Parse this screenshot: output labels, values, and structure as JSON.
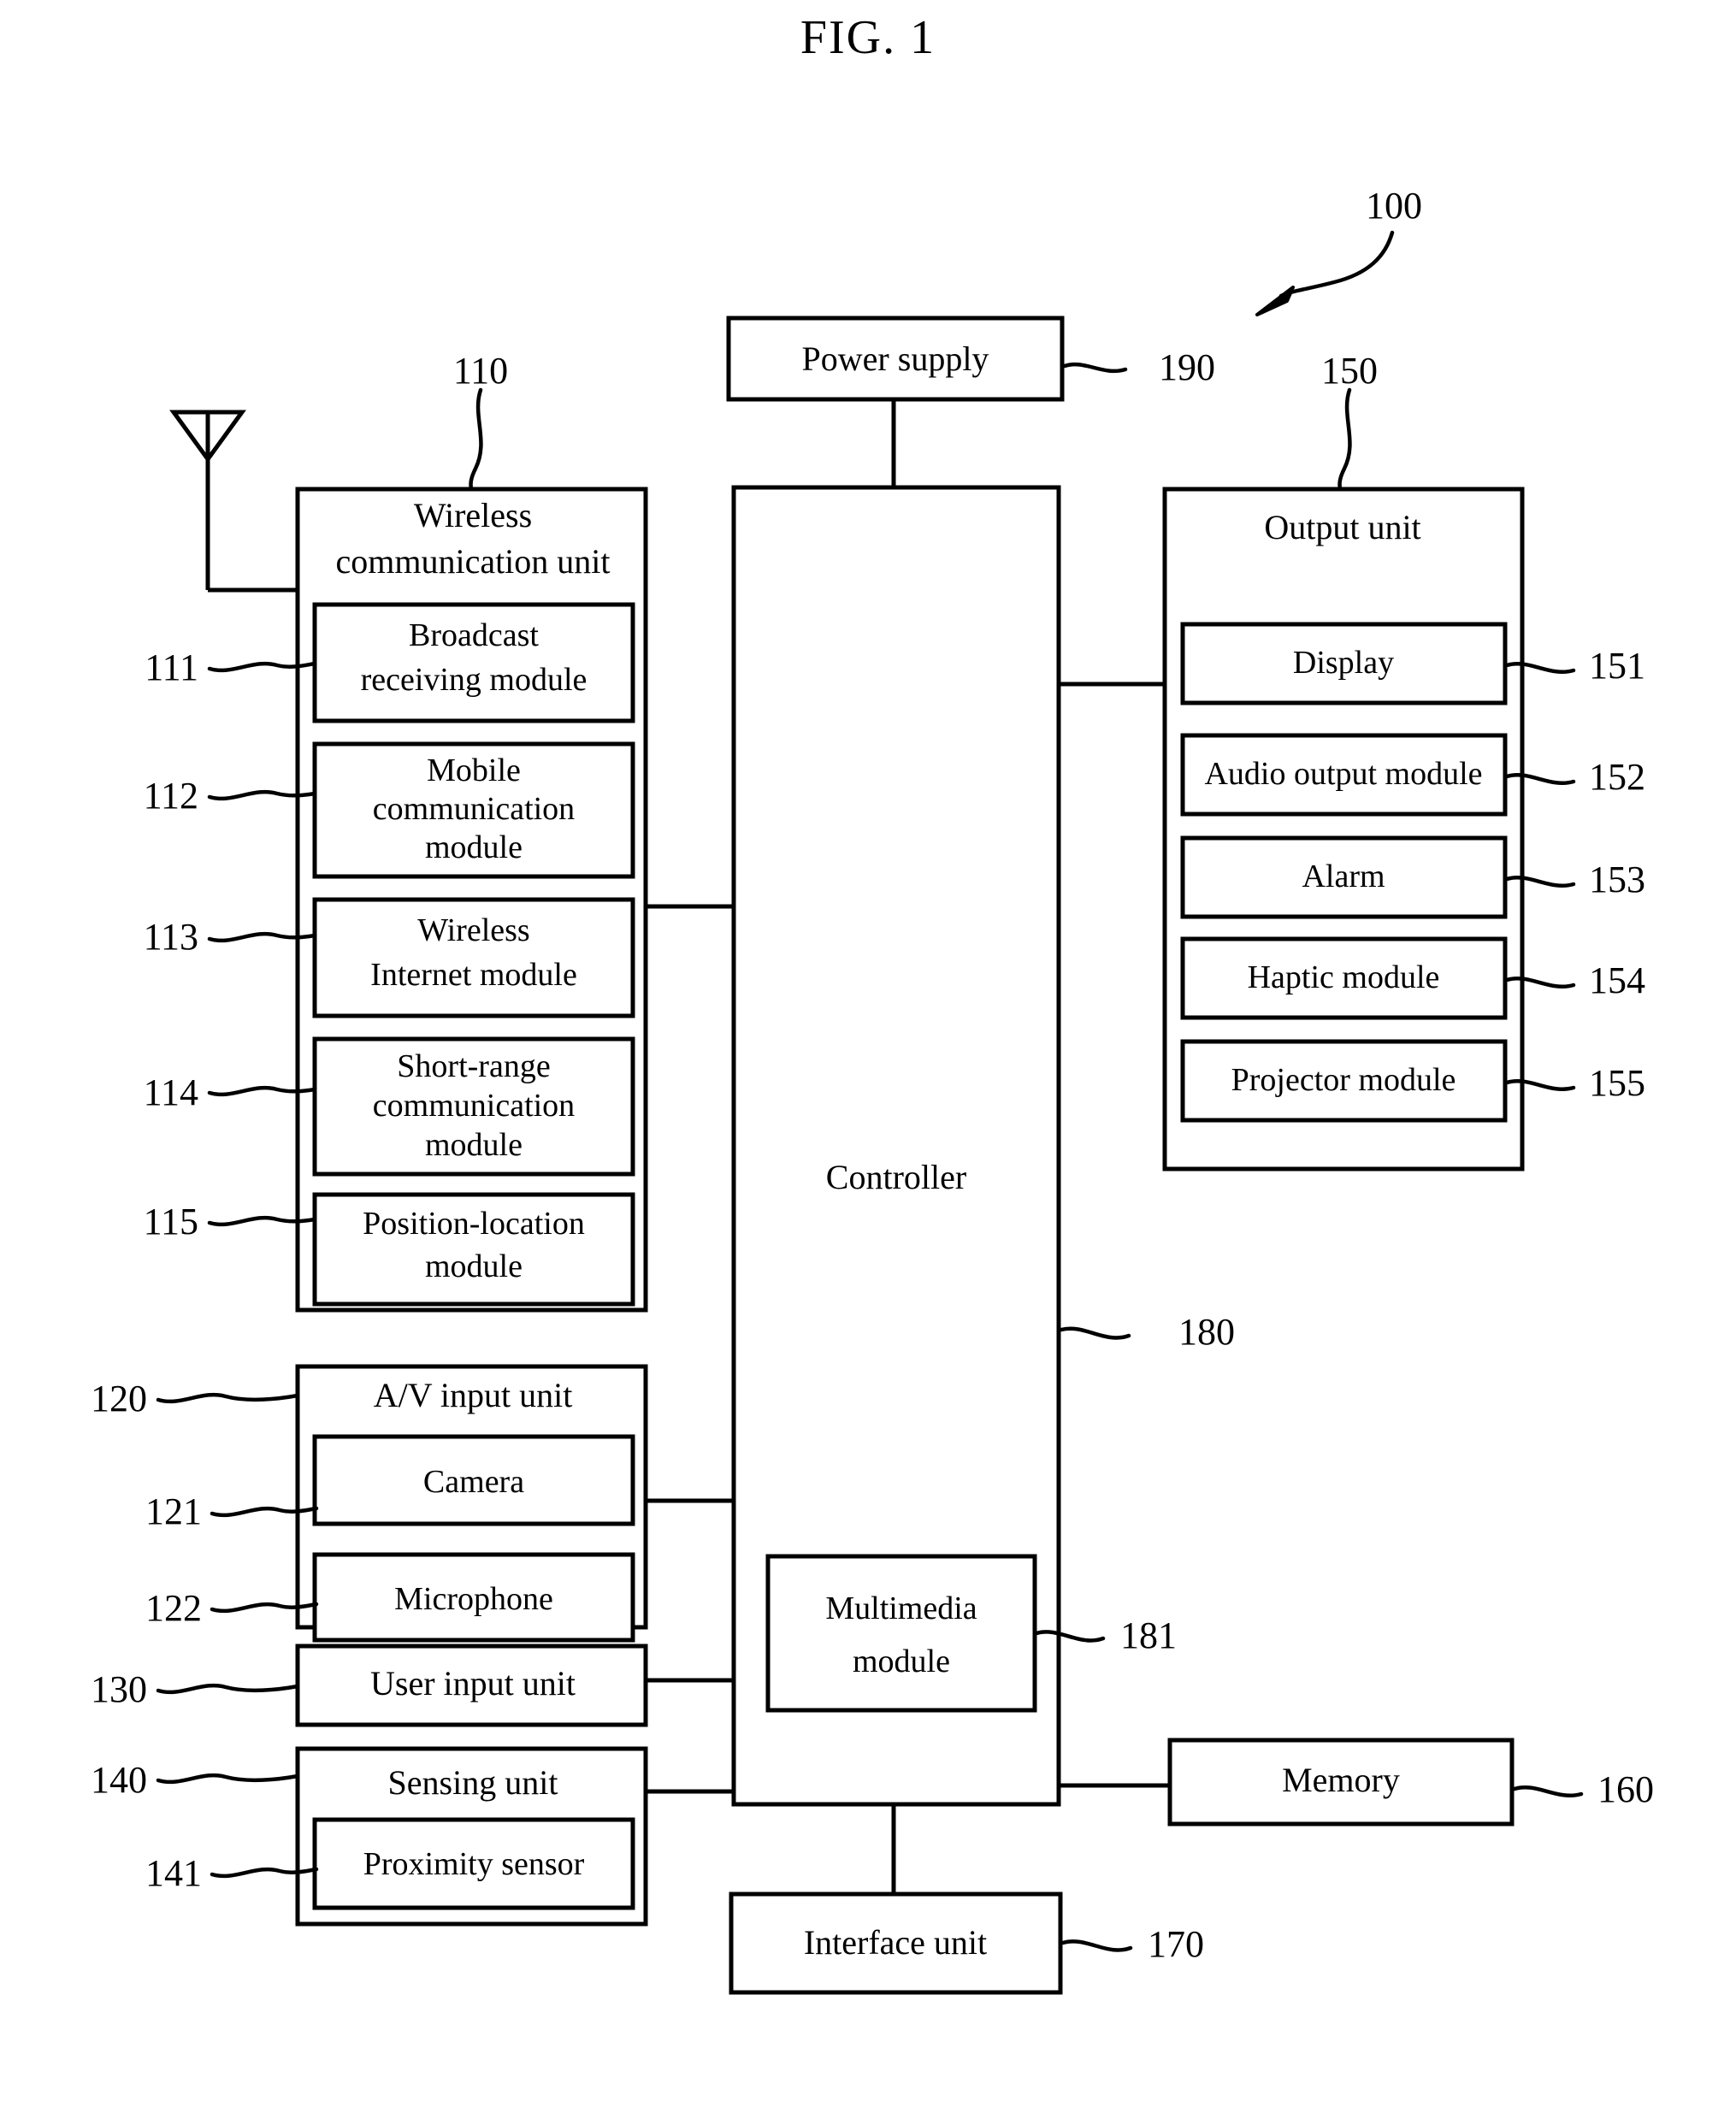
{
  "figure": {
    "title": "FIG. 1",
    "device_ref": "100"
  },
  "blocks": {
    "power_supply": {
      "label": "Power supply",
      "ref": "190"
    },
    "controller": {
      "label": "Controller",
      "ref": "180"
    },
    "multimedia_module": {
      "label": "Multimedia module",
      "line1": "Multimedia",
      "line2": "module",
      "ref": "181"
    },
    "memory": {
      "label": "Memory",
      "ref": "160"
    },
    "interface_unit": {
      "label": "Interface unit",
      "ref": "170"
    },
    "wireless_communication_unit": {
      "line1": "Wireless",
      "line2": "communication unit",
      "ref": "110",
      "modules": [
        {
          "ref": "111",
          "line1": "Broadcast",
          "line2": "receiving module",
          "line3": ""
        },
        {
          "ref": "112",
          "line1": "Mobile",
          "line2": "communication",
          "line3": "module"
        },
        {
          "ref": "113",
          "line1": "Wireless",
          "line2": "Internet module",
          "line3": ""
        },
        {
          "ref": "114",
          "line1": "Short-range",
          "line2": "communication",
          "line3": "module"
        },
        {
          "ref": "115",
          "line1": "Position-location",
          "line2": "module",
          "line3": ""
        }
      ]
    },
    "av_input_unit": {
      "label": "A/V input unit",
      "ref": "120",
      "modules": [
        {
          "ref": "121",
          "label": "Camera"
        },
        {
          "ref": "122",
          "label": "Microphone"
        }
      ]
    },
    "user_input_unit": {
      "label": "User input unit",
      "ref": "130"
    },
    "sensing_unit": {
      "label": "Sensing unit",
      "ref": "140",
      "modules": [
        {
          "ref": "141",
          "label": "Proximity sensor"
        }
      ]
    },
    "output_unit": {
      "label": "Output unit",
      "ref": "150",
      "modules": [
        {
          "ref": "151",
          "label": "Display"
        },
        {
          "ref": "152",
          "label": "Audio output module"
        },
        {
          "ref": "153",
          "label": "Alarm"
        },
        {
          "ref": "154",
          "label": "Haptic module"
        },
        {
          "ref": "155",
          "label": "Projector module"
        }
      ]
    },
    "antenna": {
      "name": "antenna-symbol"
    }
  },
  "colors": {
    "stroke": "#000000",
    "background": "#ffffff"
  }
}
